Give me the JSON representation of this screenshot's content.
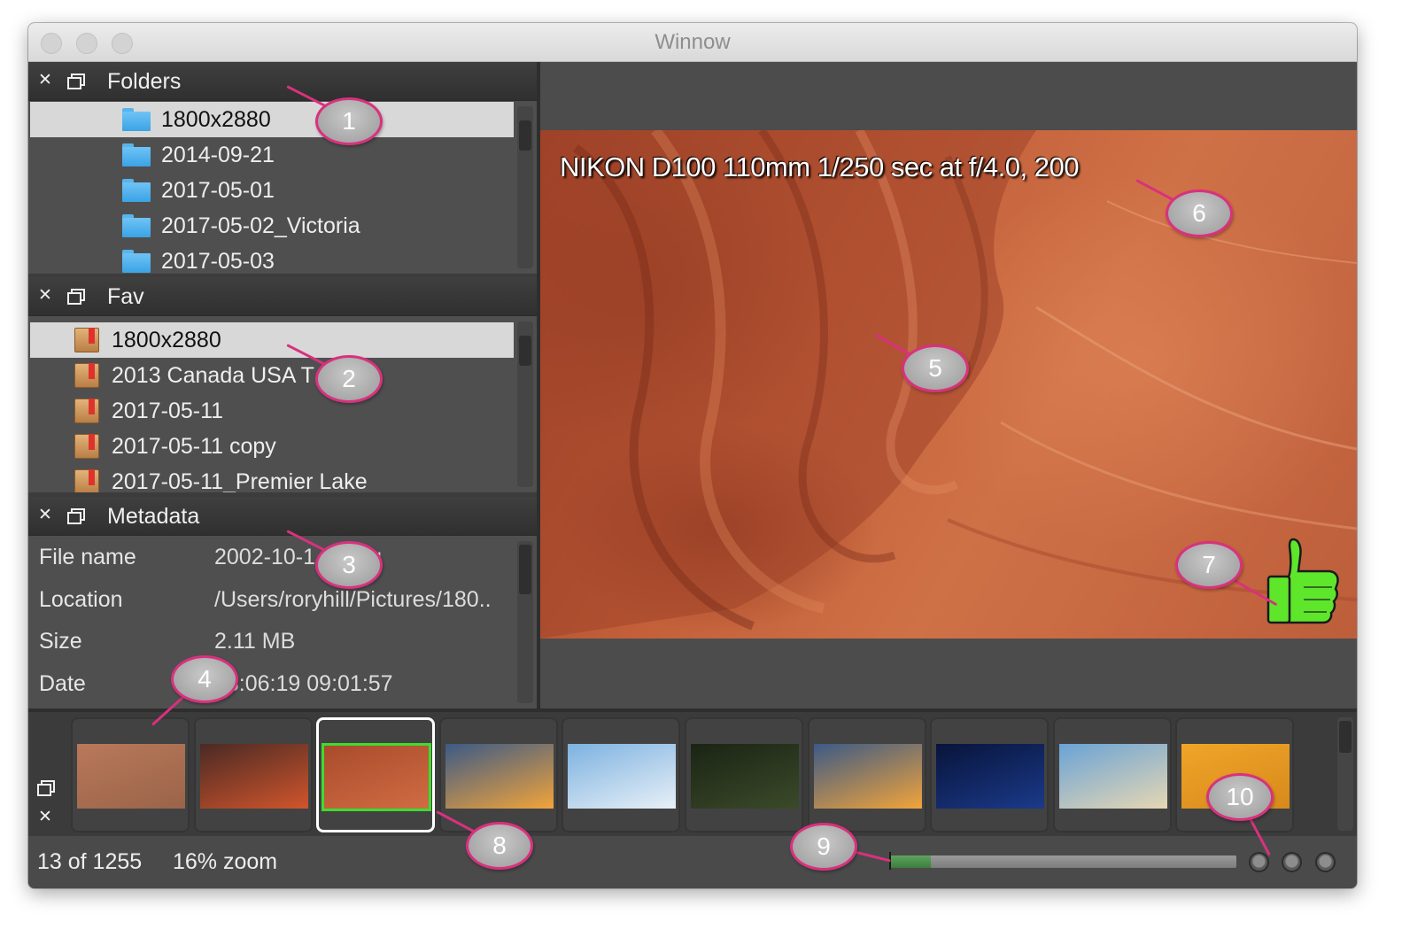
{
  "window": {
    "title": "Winnow"
  },
  "panels": {
    "folders": {
      "title": "Folders",
      "items": [
        {
          "label": "1800x2880",
          "selected": true
        },
        {
          "label": "2014-09-21"
        },
        {
          "label": "2017-05-01"
        },
        {
          "label": "2017-05-02_Victoria"
        },
        {
          "label": "2017-05-03"
        }
      ]
    },
    "fav": {
      "title": "Fav",
      "items": [
        {
          "label": "1800x2880",
          "selected": true
        },
        {
          "label": "2013 Canada USA T"
        },
        {
          "label": "2017-05-11"
        },
        {
          "label": "2017-05-11 copy"
        },
        {
          "label": "2017-05-11_Premier Lake"
        }
      ]
    },
    "metadata": {
      "title": "Metadata",
      "rows": [
        {
          "key": "File name",
          "value": "2002-10-1 20.jpg"
        },
        {
          "key": "Location",
          "value": "/Users/roryhill/Pictures/180.."
        },
        {
          "key": "Size",
          "value": "2.11 MB"
        },
        {
          "key": "Date",
          "value": "13:06:19 09:01:57"
        }
      ]
    }
  },
  "viewer": {
    "exif_overlay": "NIKON D100  110mm  1/250 sec at f/4.0, 200",
    "pick_icon": "thumbs-up-icon",
    "pick_color": "#5ee62b"
  },
  "filmstrip": {
    "current_index": 2,
    "current_border_color": "#3ddc2f",
    "thumbnails": [
      {
        "name": "cracked-earth",
        "colors": [
          "#b9785a",
          "#9a6449"
        ]
      },
      {
        "name": "red-cliffs-storm",
        "colors": [
          "#4a2a24",
          "#d0552c"
        ]
      },
      {
        "name": "red-sandstone",
        "colors": [
          "#a94b2c",
          "#d06c43"
        ]
      },
      {
        "name": "coast-sunset-birds",
        "colors": [
          "#3c5a86",
          "#f2a43a"
        ]
      },
      {
        "name": "snowy-mountain",
        "colors": [
          "#7db2e0",
          "#e8f0f7"
        ]
      },
      {
        "name": "birds-dark-forest",
        "colors": [
          "#1b2414",
          "#3b4a2a"
        ]
      },
      {
        "name": "coast-sunset",
        "colors": [
          "#3c5a86",
          "#f2a43a"
        ]
      },
      {
        "name": "night-bench",
        "colors": [
          "#08143a",
          "#1b3a8a"
        ]
      },
      {
        "name": "sand-dune",
        "colors": [
          "#6aa3d6",
          "#e6d7b3"
        ]
      },
      {
        "name": "orange-rock-silhouette",
        "colors": [
          "#f0a528",
          "#d8891c"
        ]
      }
    ]
  },
  "status": {
    "count": "13 of 1255",
    "zoom": "16% zoom",
    "progress": 0.12,
    "indicator_count": 3
  },
  "callouts": [
    "1",
    "2",
    "3",
    "4",
    "5",
    "6",
    "7",
    "8",
    "9",
    "10"
  ]
}
